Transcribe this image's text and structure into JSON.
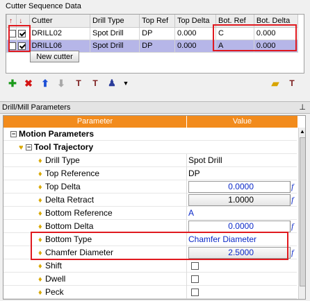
{
  "cutter_section": {
    "title": "Cutter Sequence Data",
    "columns": [
      "",
      "",
      "Cutter",
      "Drill Type",
      "Top Ref",
      "Top Delta",
      "Bot. Ref",
      "Bot. Delta"
    ],
    "rows": [
      {
        "cutter": "DRILL02",
        "drill_type": "Spot Drill",
        "top_ref": "DP",
        "top_delta": "0.000",
        "bot_ref": "C",
        "bot_delta": "0.000",
        "checked_a": false,
        "checked_b": true,
        "selected": false
      },
      {
        "cutter": "DRILL06",
        "drill_type": "Spot Drill",
        "top_ref": "DP",
        "top_delta": "0.000",
        "bot_ref": "A",
        "bot_delta": "0.000",
        "checked_a": false,
        "checked_b": true,
        "selected": true
      }
    ],
    "new_cutter_label": "New cutter"
  },
  "toolbar": {
    "buttons": [
      "add-cutter-icon",
      "delete-cutter-icon",
      "move-up-icon",
      "move-down-icon",
      "tool-edit-icon",
      "tool-copy-icon",
      "tool-assign-icon",
      "dropdown-arrow-icon",
      "open-folder-icon",
      "save-tool-icon"
    ]
  },
  "params_panel": {
    "title": "Drill/Mill Parameters",
    "col_parameter": "Parameter",
    "col_value": "Value",
    "group": "Motion Parameters",
    "subgroup": "Tool Trajectory",
    "items": [
      {
        "name": "Drill Type",
        "value": "Spot Drill",
        "kind": "text"
      },
      {
        "name": "Top Reference",
        "value": "DP",
        "kind": "text"
      },
      {
        "name": "Top Delta",
        "value": "0.0000",
        "kind": "number"
      },
      {
        "name": "Delta Retract",
        "value": "1.0000",
        "kind": "number"
      },
      {
        "name": "Bottom Reference",
        "value": "A",
        "kind": "link"
      },
      {
        "name": "Bottom Delta",
        "value": "0.0000",
        "kind": "number"
      },
      {
        "name": "Bottom Type",
        "value": "Chamfer Diameter",
        "kind": "link"
      },
      {
        "name": "Chamfer Diameter",
        "value": "2.5000",
        "kind": "number"
      },
      {
        "name": "Shift",
        "value": "",
        "kind": "check"
      },
      {
        "name": "Dwell",
        "value": "",
        "kind": "check"
      },
      {
        "name": "Peck",
        "value": "",
        "kind": "check"
      }
    ]
  },
  "colors": {
    "header_orange": "#f28b1c",
    "selection": "#b6b6e8",
    "highlight_red": "#e0191f",
    "value_blue": "#0a28c8"
  }
}
